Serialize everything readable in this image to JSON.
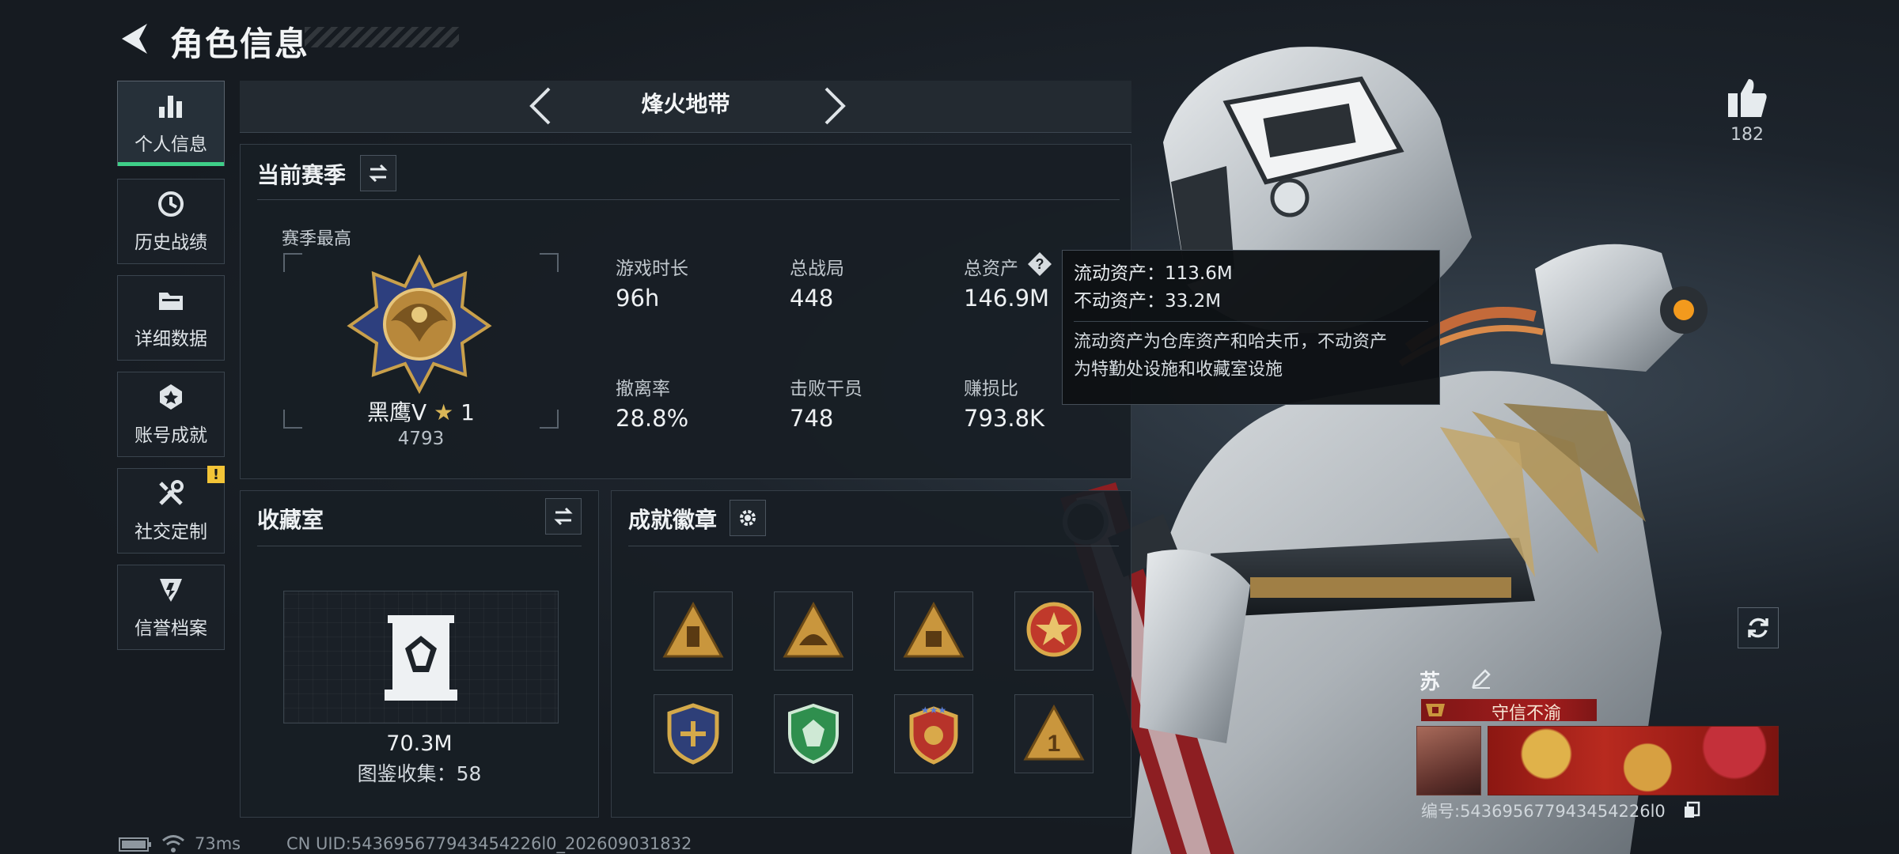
{
  "header": {
    "title": "角色信息"
  },
  "sidebar": {
    "items": [
      {
        "label": "个人信息",
        "icon": "bar-chart-icon"
      },
      {
        "label": "历史战绩",
        "icon": "history-icon"
      },
      {
        "label": "详细数据",
        "icon": "folder-icon"
      },
      {
        "label": "账号成就",
        "icon": "achievement-icon"
      },
      {
        "label": "社交定制",
        "icon": "tools-icon"
      },
      {
        "label": "信誉档案",
        "icon": "credit-icon"
      }
    ],
    "alert_badge": "!"
  },
  "mode": {
    "name": "烽火地带"
  },
  "season": {
    "title": "当前赛季",
    "best_label": "赛季最高",
    "rank_name": "黑鹰V",
    "rank_stars": "1",
    "rank_score": "4793",
    "stats": [
      {
        "label": "游戏时长",
        "value": "96h"
      },
      {
        "label": "总战局",
        "value": "448"
      },
      {
        "label": "总资产",
        "value": "146.9M"
      },
      {
        "label": "撤离率",
        "value": "28.8%"
      },
      {
        "label": "击败干员",
        "value": "748"
      },
      {
        "label": "赚损比",
        "value": "793.8K"
      }
    ]
  },
  "tooltip": {
    "liquid": "流动资产：113.6M",
    "fixed": "不动资产：33.2M",
    "desc_line1": "流动资产为仓库资产和哈夫币，不动资产",
    "desc_line2": "为特勤处设施和收藏室设施"
  },
  "collection": {
    "title": "收藏室",
    "value": "70.3M",
    "count_text": "图鉴收集：58"
  },
  "badges": {
    "title": "成就徽章",
    "items": [
      {
        "icon": "triangle-tower-badge-icon",
        "color": "#c9963d"
      },
      {
        "icon": "triangle-helmet-badge-icon",
        "color": "#c9963d"
      },
      {
        "icon": "triangle-cargo-badge-icon",
        "color": "#c9963d"
      },
      {
        "icon": "star-medal-badge-icon",
        "color": "#c0392b"
      },
      {
        "icon": "shield-gold-badge-icon",
        "color": "#d4a94a"
      },
      {
        "icon": "shield-green-badge-icon",
        "color": "#2f8f4e"
      },
      {
        "icon": "shield-red-stars-badge-icon",
        "color": "#b7332a"
      },
      {
        "icon": "triangle-number-badge-icon",
        "color": "#c9963d",
        "label": "1"
      }
    ]
  },
  "profile": {
    "likes": "182",
    "name": "苏",
    "title": "守信不渝",
    "id_text": "编号:543695677943454226l0"
  },
  "footer": {
    "ping": "73ms",
    "uid": "CN UID:543695677943454226l0_202609031832"
  }
}
